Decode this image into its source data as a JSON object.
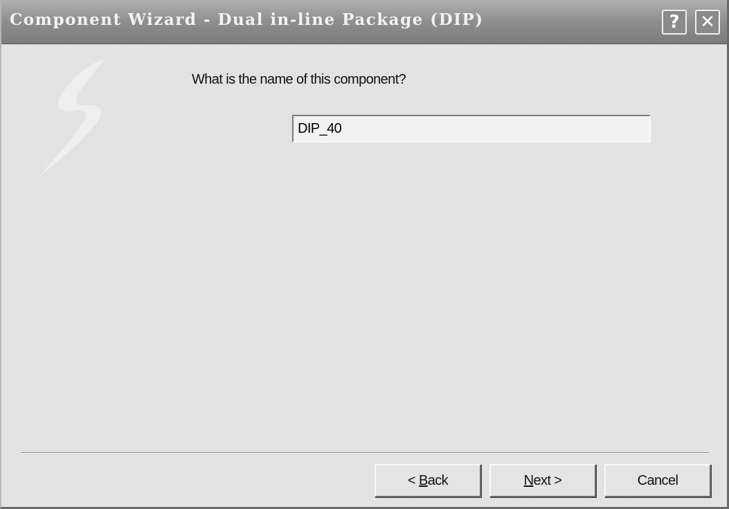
{
  "window": {
    "title": "Component Wizard - Dual in-line Package (DIP)",
    "help_label": "?",
    "close_label": "✕"
  },
  "page": {
    "prompt": "What is the name of this component?",
    "name_value": "DIP_40"
  },
  "buttons": {
    "back": {
      "arrow": "< ",
      "mnemonic": "B",
      "rest": "ack"
    },
    "next": {
      "mnemonic": "N",
      "rest": "ext",
      "arrow": " >"
    },
    "cancel": "Cancel"
  },
  "icons": {
    "logo": "wizard-lightning-icon",
    "help": "help-icon",
    "close": "close-icon"
  }
}
